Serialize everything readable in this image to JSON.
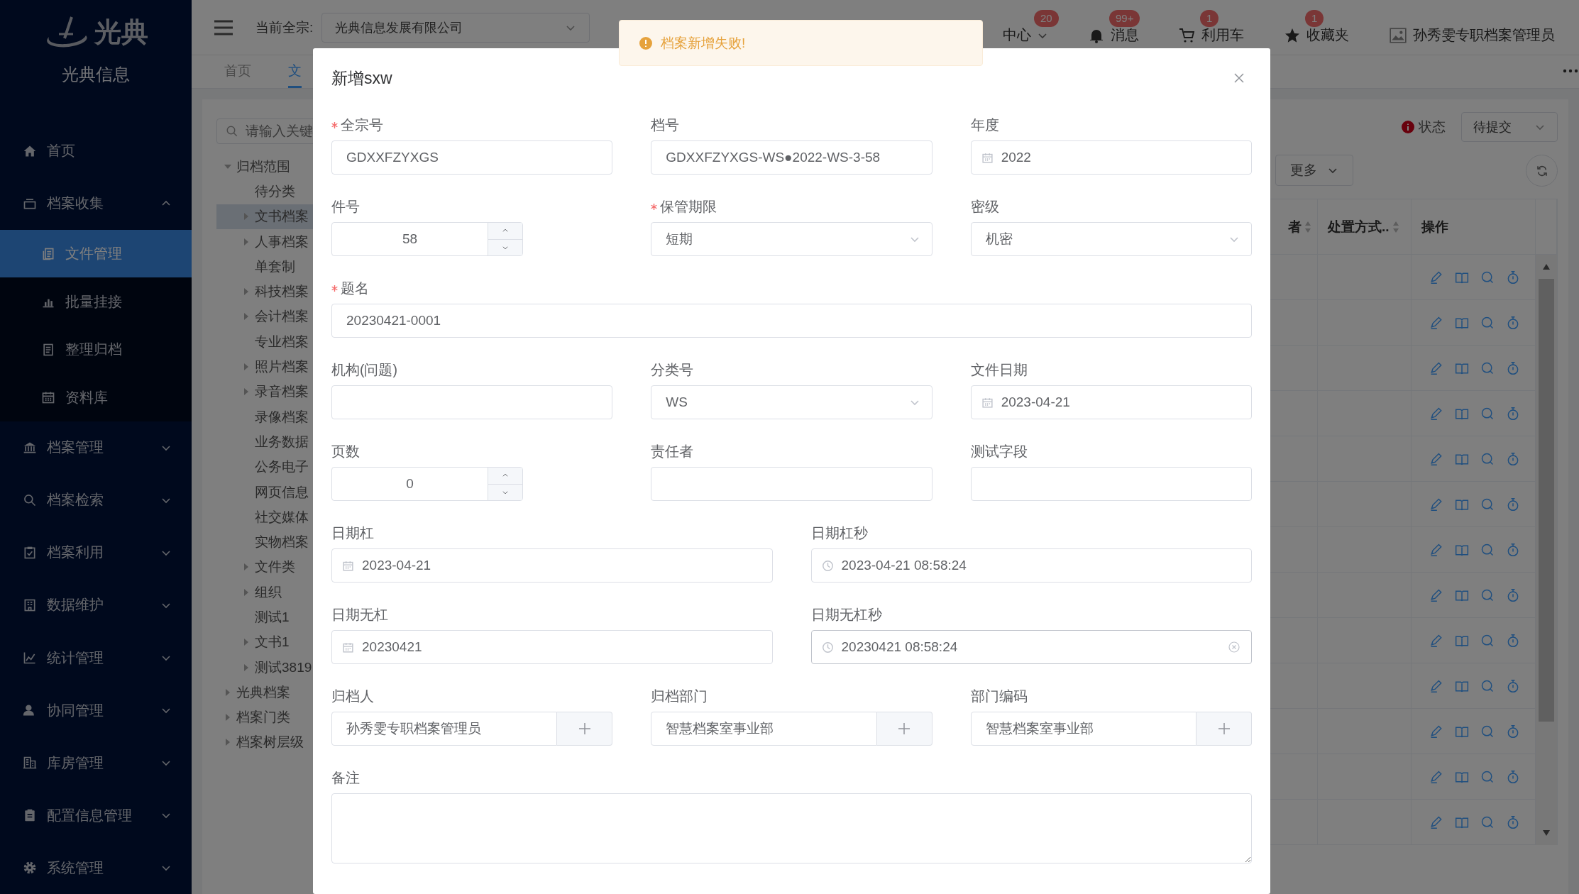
{
  "sidebar": {
    "logo_text": "光典",
    "brand": "光典信息",
    "items": [
      {
        "kind": "link",
        "label": "首页",
        "selected": false
      },
      {
        "kind": "menu",
        "label": "档案收集",
        "selected": false,
        "expanded": true,
        "children": [
          {
            "label": "文件管理",
            "selected": true
          },
          {
            "label": "批量挂接",
            "selected": false
          },
          {
            "label": "整理归档",
            "selected": false
          },
          {
            "label": "资料库",
            "selected": false
          }
        ]
      },
      {
        "kind": "menu",
        "label": "档案管理",
        "selected": false,
        "expanded": false
      },
      {
        "kind": "menu",
        "label": "档案检索",
        "selected": false,
        "expanded": false
      },
      {
        "kind": "menu",
        "label": "档案利用",
        "selected": false,
        "expanded": false
      },
      {
        "kind": "menu",
        "label": "数据维护",
        "selected": false,
        "expanded": false
      },
      {
        "kind": "menu",
        "label": "统计管理",
        "selected": false,
        "expanded": false
      },
      {
        "kind": "menu",
        "label": "协同管理",
        "selected": false,
        "expanded": false
      },
      {
        "kind": "menu",
        "label": "库房管理",
        "selected": false,
        "expanded": false
      },
      {
        "kind": "menu",
        "label": "配置信息管理",
        "selected": false,
        "expanded": false
      },
      {
        "kind": "menu",
        "label": "系统管理",
        "selected": false,
        "expanded": false
      }
    ]
  },
  "header": {
    "fonds_label": "当前全宗:",
    "fonds_value": "光典信息发展有限公司",
    "items": [
      {
        "label": "中心",
        "badge": "20",
        "dropdown": true
      },
      {
        "label": "消息",
        "badge": "99+",
        "dropdown": false
      },
      {
        "label": "利用车",
        "badge": "1",
        "dropdown": false
      },
      {
        "label": "收藏夹",
        "badge": "1",
        "dropdown": false
      }
    ],
    "user": "孙秀雯专职档案管理员"
  },
  "tabs": [
    {
      "label": "首页",
      "selected": false
    },
    {
      "label": "文",
      "selected": true
    }
  ],
  "tree": {
    "search_placeholder": "请输入关键",
    "nodes": [
      {
        "label": "归档范围",
        "expandable": true,
        "expanded": true,
        "selected": false,
        "children": [
          {
            "label": "待分类",
            "expandable": false,
            "selected": false
          },
          {
            "label": "文书档案",
            "expandable": true,
            "expanded": false,
            "selected": true
          },
          {
            "label": "人事档案",
            "expandable": true,
            "expanded": false,
            "selected": false
          },
          {
            "label": "单套制",
            "expandable": false,
            "selected": false
          },
          {
            "label": "科技档案",
            "expandable": true,
            "expanded": false,
            "selected": false
          },
          {
            "label": "会计档案",
            "expandable": true,
            "expanded": false,
            "selected": false
          },
          {
            "label": "专业档案",
            "expandable": false,
            "selected": false
          },
          {
            "label": "照片档案",
            "expandable": true,
            "expanded": false,
            "selected": false
          },
          {
            "label": "录音档案",
            "expandable": true,
            "expanded": false,
            "selected": false
          },
          {
            "label": "录像档案",
            "expandable": false,
            "selected": false
          },
          {
            "label": "业务数据",
            "expandable": false,
            "selected": false
          },
          {
            "label": "公务电子",
            "expandable": false,
            "selected": false
          },
          {
            "label": "网页信息",
            "expandable": false,
            "selected": false
          },
          {
            "label": "社交媒体",
            "expandable": false,
            "selected": false
          },
          {
            "label": "实物档案",
            "expandable": false,
            "selected": false
          },
          {
            "label": "文件类",
            "expandable": true,
            "expanded": false,
            "selected": false
          },
          {
            "label": "组织",
            "expandable": true,
            "expanded": false,
            "selected": false
          },
          {
            "label": "测试1",
            "expandable": false,
            "selected": false
          },
          {
            "label": "文书1",
            "expandable": true,
            "expanded": false,
            "selected": false
          },
          {
            "label": "测试3819",
            "expandable": true,
            "expanded": false,
            "selected": false
          }
        ]
      },
      {
        "label": "光典档案",
        "expandable": true,
        "expanded": false,
        "selected": false
      },
      {
        "label": "档案门类",
        "expandable": true,
        "expanded": false,
        "selected": false
      },
      {
        "label": "档案树层级",
        "expandable": true,
        "expanded": false,
        "selected": false
      }
    ]
  },
  "filters": {
    "status_label": "状态",
    "status_value": "待提交",
    "more_button": "更多"
  },
  "table": {
    "columns": [
      {
        "label": "者",
        "sortable": true
      },
      {
        "label": "处置方式..",
        "sortable": true
      },
      {
        "label": "操作",
        "sortable": false
      }
    ]
  },
  "toast": {
    "kind": "warning",
    "text": "档案新增失败!"
  },
  "dialog": {
    "title": "新增sxw",
    "rows": [
      [
        {
          "label": "全宗号",
          "required": true,
          "kind": "text",
          "value": "GDXXFZYXGS",
          "hover": false
        },
        {
          "label": "档号",
          "required": false,
          "kind": "text",
          "value": "GDXXFZYXGS-WS●2022-WS-3-58",
          "hover": false
        },
        {
          "label": "年度",
          "required": false,
          "kind": "date",
          "value": "2022",
          "hover": false
        }
      ],
      [
        {
          "label": "件号",
          "required": false,
          "kind": "number",
          "value": "58",
          "hover": false
        },
        {
          "label": "保管期限",
          "required": true,
          "kind": "select",
          "value": "短期",
          "hover": false
        },
        {
          "label": "密级",
          "required": false,
          "kind": "select",
          "value": "机密",
          "hover": false
        }
      ],
      [
        {
          "label": "题名",
          "required": true,
          "kind": "text",
          "value": "20230421-0001",
          "hover": false
        }
      ],
      [
        {
          "label": "机构(问题)",
          "required": false,
          "kind": "text",
          "hover": false
        },
        {
          "label": "分类号",
          "required": false,
          "kind": "select",
          "value": "WS",
          "hover": false
        },
        {
          "label": "文件日期",
          "required": false,
          "kind": "date",
          "value": "2023-04-21",
          "hover": false
        }
      ],
      [
        {
          "label": "页数",
          "required": false,
          "kind": "number",
          "value": "0",
          "hover": false
        },
        {
          "label": "责任者",
          "required": false,
          "kind": "text",
          "hover": false
        },
        {
          "label": "测试字段",
          "required": false,
          "kind": "text",
          "hover": false
        }
      ],
      [
        {
          "label": "日期杠",
          "required": false,
          "kind": "date",
          "value": "2023-04-21",
          "hover": false
        },
        {
          "label": "日期杠秒",
          "required": false,
          "kind": "datetime",
          "value": "2023-04-21 08:58:24",
          "hover": false
        }
      ],
      [
        {
          "label": "日期无杠",
          "required": false,
          "kind": "date",
          "value": "20230421",
          "hover": false
        },
        {
          "label": "日期无杠秒",
          "required": false,
          "kind": "datetime",
          "value": "20230421 08:58:24",
          "hover": true
        }
      ],
      [
        {
          "label": "归档人",
          "required": false,
          "kind": "picker",
          "value": "孙秀雯专职档案管理员",
          "hover": false
        },
        {
          "label": "归档部门",
          "required": false,
          "kind": "picker",
          "value": "智慧档案室事业部",
          "hover": false
        },
        {
          "label": "部门编码",
          "required": false,
          "kind": "picker",
          "value": "智慧档案室事业部",
          "hover": false
        }
      ],
      [
        {
          "label": "备注",
          "required": false,
          "kind": "textarea",
          "hover": false
        }
      ]
    ]
  }
}
